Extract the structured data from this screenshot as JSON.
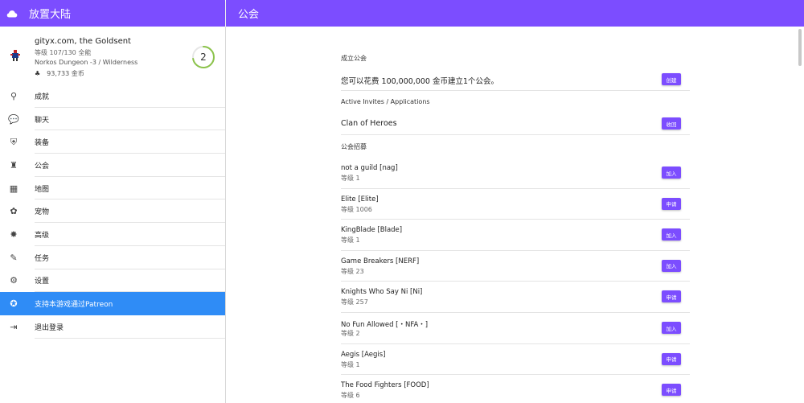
{
  "app": {
    "title": "放置大陆"
  },
  "page": {
    "title": "公会"
  },
  "profile": {
    "name": "gityx.com, the Goldsent",
    "level": "等级 107/130 全能",
    "location": "Norkos Dungeon -3 / Wilderness",
    "gold": "93,733 金币",
    "ring_value": "2",
    "ring_progress": 0.72
  },
  "nav": [
    {
      "label": "成就",
      "icon": "trophy-icon",
      "glyph": "⚲"
    },
    {
      "label": "聊天",
      "icon": "chat-icon",
      "glyph": "💬"
    },
    {
      "label": "装备",
      "icon": "armor-icon",
      "glyph": "⛨"
    },
    {
      "label": "公会",
      "icon": "castle-icon",
      "glyph": "♜"
    },
    {
      "label": "地图",
      "icon": "map-icon",
      "glyph": "▦"
    },
    {
      "label": "宠物",
      "icon": "paw-icon",
      "glyph": "✿"
    },
    {
      "label": "高级",
      "icon": "premium-icon",
      "glyph": "✸"
    },
    {
      "label": "任务",
      "icon": "quest-icon",
      "glyph": "✎"
    },
    {
      "label": "设置",
      "icon": "gear-icon",
      "glyph": "⚙"
    },
    {
      "label": "支持本游戏通过Patreon",
      "icon": "patreon-icon",
      "glyph": "✪"
    },
    {
      "label": "退出登录",
      "icon": "logout-icon",
      "glyph": "⇥"
    }
  ],
  "guild": {
    "create_section": "成立公会",
    "create_text": "您可以花费 100,000,000 金币建立1个公会。",
    "create_button": "创建",
    "invites_section": "Active Invites / Applications",
    "invite_guild": "Clan of Heroes",
    "invite_button": "收回",
    "recruit_section": "公会招募",
    "recruits": [
      {
        "name": "not a guild [nag]",
        "level": "等级 1",
        "button": "加入"
      },
      {
        "name": "Elite [Elite]",
        "level": "等级 1006",
        "button": "申请"
      },
      {
        "name": "KingBlade [Blade]",
        "level": "等级 1",
        "button": "加入"
      },
      {
        "name": "Game Breakers [NERF]",
        "level": "等级 23",
        "button": "加入"
      },
      {
        "name": "Knights Who Say Ni [Ni]",
        "level": "等级 257",
        "button": "申请"
      },
      {
        "name": "No Fun Allowed [・NFA・]",
        "level": "等级 2",
        "button": "加入"
      },
      {
        "name": "Aegis [Aegis]",
        "level": "等级 1",
        "button": "申请"
      },
      {
        "name": "The Food Fighters [FOOD]",
        "level": "等级 6",
        "button": "申请"
      }
    ]
  },
  "colors": {
    "accent": "#7c4dff",
    "active_nav": "#2f8cf6",
    "ring": "#8bc34a"
  }
}
